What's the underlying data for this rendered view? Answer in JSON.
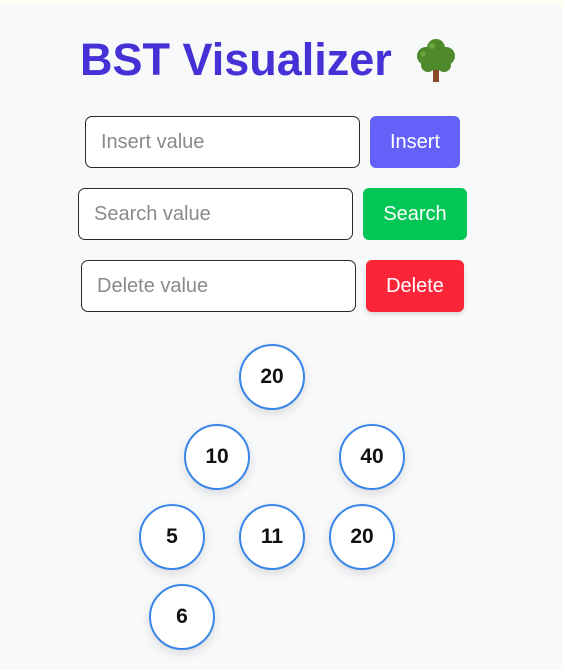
{
  "app": {
    "title": "BST Visualizer",
    "title_icon": "tree-icon"
  },
  "colors": {
    "title": "#4630d6",
    "insert_button": "#6461f9",
    "search_button": "#02c656",
    "delete_button": "#fb2537",
    "node_border": "#3a86e8"
  },
  "controls": {
    "insert": {
      "placeholder": "Insert value",
      "value": "",
      "button_label": "Insert"
    },
    "search": {
      "placeholder": "Search value",
      "value": "",
      "button_label": "Search"
    },
    "delete": {
      "placeholder": "Delete value",
      "value": "",
      "button_label": "Delete"
    }
  },
  "tree": {
    "nodes": [
      {
        "value": "20"
      },
      {
        "value": "10"
      },
      {
        "value": "40"
      },
      {
        "value": "5"
      },
      {
        "value": "11"
      },
      {
        "value": "20"
      },
      {
        "value": "6"
      }
    ]
  }
}
